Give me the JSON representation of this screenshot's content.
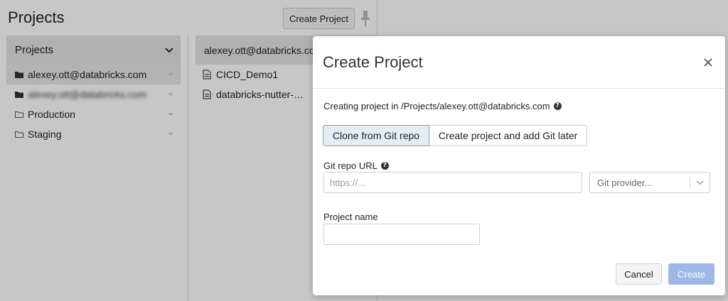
{
  "page": {
    "title": "Projects",
    "create_button": "Create Project"
  },
  "sidebar": {
    "header": "Projects",
    "items": [
      {
        "label": "alexey.ott@databricks.com",
        "selected": true
      },
      {
        "label": "alexey.ott@databricks.com",
        "blurred": true
      },
      {
        "label": "Production"
      },
      {
        "label": "Staging"
      }
    ]
  },
  "files": {
    "header": "alexey.ott@databricks.com",
    "items": [
      {
        "label": "CICD_Demo1"
      },
      {
        "label": "databricks-nutter-projects-demo"
      }
    ]
  },
  "modal": {
    "title": "Create Project",
    "location_text": "Creating project in /Projects/alexey.ott@databricks.com",
    "tab_clone": "Clone from Git repo",
    "tab_later": "Create project and add Git later",
    "git_url_label": "Git repo URL",
    "git_url_placeholder": "https://...",
    "git_provider_placeholder": "Git provider...",
    "project_name_label": "Project name",
    "project_name_value": "",
    "cancel_label": "Cancel",
    "create_label": "Create"
  },
  "colors": {
    "overlay": "#000000",
    "create_button_disabled": "#9db8e6",
    "active_tab": "#e6ecf3"
  },
  "icons": [
    "pin-icon",
    "chevron-down-icon",
    "folder-icon",
    "file-icon",
    "close-icon",
    "help-icon"
  ]
}
